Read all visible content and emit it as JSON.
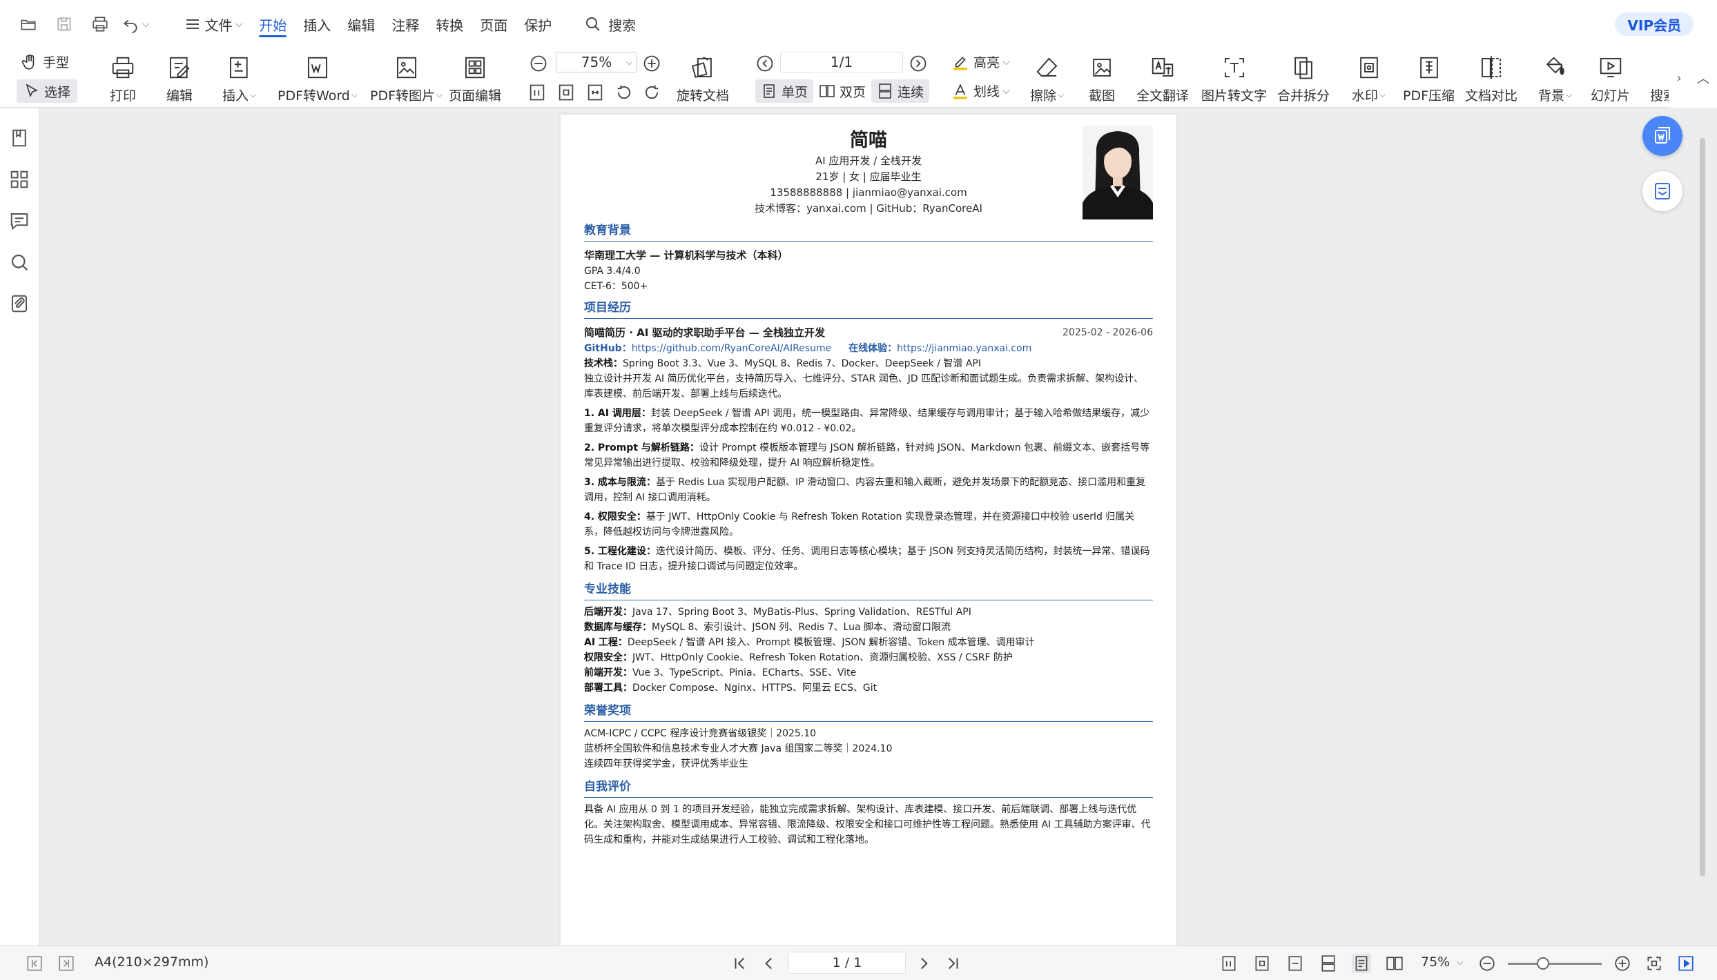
{
  "menu": {
    "tabs": [
      "文件",
      "开始",
      "插入",
      "编辑",
      "注释",
      "转换",
      "页面",
      "保护"
    ],
    "search": "搜索",
    "vip": "VIP会员"
  },
  "ribbon": {
    "hand": "手型",
    "select": "选择",
    "print": "打印",
    "edit": "编辑",
    "insert": "插入",
    "pdf_word": "PDF转Word",
    "pdf_image": "PDF转图片",
    "page_edit": "页面编辑",
    "zoom": "75%",
    "rotate": "旋转文档",
    "page_indicator": "1/1",
    "single": "单页",
    "double": "双页",
    "continuous": "连续",
    "highlight": "高亮",
    "underline": "划线",
    "erase": "擦除",
    "screenshot": "截图",
    "translate": "全文翻译",
    "img_to_text": "图片转文字",
    "merge_split": "合并拆分",
    "watermark": "水印",
    "compress": "PDF压缩",
    "compare": "文档对比",
    "background": "背景",
    "slideshow": "幻灯片",
    "search_more": "搜索"
  },
  "resume": {
    "name": "简喵",
    "role": "AI 应用开发 / 全栈开发",
    "basic": "21岁 | 女 | 应届毕业生",
    "contact": "13588888888 | jianmiao@yanxai.com",
    "blog": "技术博客：yanxai.com | GitHub：RyanCoreAI",
    "sections": {
      "education": "教育背景",
      "projects": "项目经历",
      "skills": "专业技能",
      "awards": "荣誉奖项",
      "self": "自我评价"
    },
    "education": {
      "school": "华南理工大学 — 计算机科学与技术（本科）",
      "gpa": "GPA 3.4/4.0",
      "cet": "CET-6：500+"
    },
    "project": {
      "title": "简喵简历 · AI 驱动的求职助手平台 — 全栈独立开发",
      "date": "2025-02 - 2026-06",
      "github_label": "GitHub：",
      "github_url": "https://github.com/RyanCoreAI/AIResume",
      "demo_label": "在线体验：",
      "demo_url": "https://jianmiao.yanxai.com",
      "stack_label": "技术栈：",
      "stack": "Spring Boot 3.3、Vue 3、MySQL 8、Redis 7、Docker、DeepSeek / 智谱 API",
      "intro": "独立设计并开发 AI 简历优化平台，支持简历导入、七维评分、STAR 润色、JD 匹配诊断和面试题生成。负责需求拆解、架构设计、库表建模、前后端开发、部署上线与后续迭代。",
      "points": [
        {
          "label": "1. AI 调用层：",
          "text": "封装 DeepSeek / 智谱 API 调用，统一模型路由、异常降级、结果缓存与调用审计；基于输入哈希做结果缓存，减少重复评分请求，将单次模型评分成本控制在约 ¥0.012 - ¥0.02。"
        },
        {
          "label": "2. Prompt 与解析链路：",
          "text": "设计 Prompt 模板版本管理与 JSON 解析链路，针对纯 JSON、Markdown 包裹、前缀文本、嵌套括号等常见异常输出进行提取、校验和降级处理，提升 AI 响应解析稳定性。"
        },
        {
          "label": "3. 成本与限流：",
          "text": "基于 Redis Lua 实现用户配额、IP 滑动窗口、内容去重和输入截断，避免并发场景下的配额竞态、接口滥用和重复调用，控制 AI 接口调用消耗。"
        },
        {
          "label": "4. 权限安全：",
          "text": "基于 JWT、HttpOnly Cookie 与 Refresh Token Rotation 实现登录态管理，并在资源接口中校验 userId 归属关系，降低越权访问与令牌泄露风险。"
        },
        {
          "label": "5. 工程化建设：",
          "text": "迭代设计简历、模板、评分、任务、调用日志等核心模块；基于 JSON 列支持灵活简历结构，封装统一异常、错误码和 Trace ID 日志，提升接口调试与问题定位效率。"
        }
      ]
    },
    "skills": [
      {
        "label": "后端开发：",
        "text": "Java 17、Spring Boot 3、MyBatis-Plus、Spring Validation、RESTful API"
      },
      {
        "label": "数据库与缓存：",
        "text": "MySQL 8、索引设计、JSON 列、Redis 7、Lua 脚本、滑动窗口限流"
      },
      {
        "label": "AI 工程：",
        "text": "DeepSeek / 智谱 API 接入、Prompt 模板管理、JSON 解析容错、Token 成本管理、调用审计"
      },
      {
        "label": "权限安全：",
        "text": "JWT、HttpOnly Cookie、Refresh Token Rotation、资源归属校验、XSS / CSRF 防护"
      },
      {
        "label": "前端开发：",
        "text": "Vue 3、TypeScript、Pinia、ECharts、SSE、Vite"
      },
      {
        "label": "部署工具：",
        "text": "Docker Compose、Nginx、HTTPS、阿里云 ECS、Git"
      }
    ],
    "awards": [
      "ACM-ICPC / CCPC 程序设计竞赛省级银奖｜2025.10",
      "蓝桥杯全国软件和信息技术专业人才大赛 Java 组国家二等奖｜2024.10",
      "连续四年获得奖学金，获评优秀毕业生"
    ],
    "self_eval": "具备 AI 应用从 0 到 1 的项目开发经验，能独立完成需求拆解、架构设计、库表建模、接口开发、前后端联调、部署上线与迭代优化。关注架构取舍、模型调用成本、异常容错、限流降级、权限安全和接口可维护性等工程问题。熟悉使用 AI 工具辅助方案评审、代码生成和重构，并能对生成结果进行人工校验、调试和工程化落地。"
  },
  "status": {
    "paper": "A4(210×297mm)",
    "page": "1 / 1",
    "zoom": "75%"
  }
}
